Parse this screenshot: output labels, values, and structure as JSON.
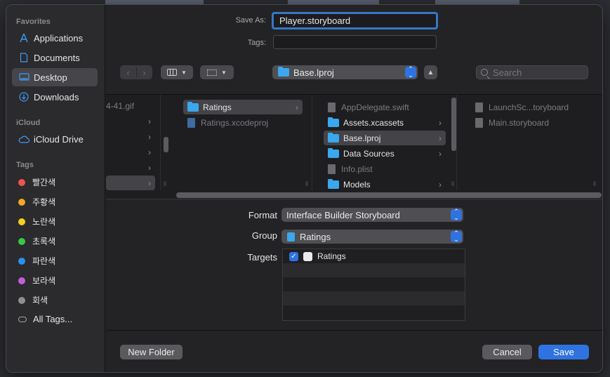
{
  "sidebar": {
    "favorites_header": "Favorites",
    "favorites": [
      {
        "label": "Applications",
        "icon": "applications-icon"
      },
      {
        "label": "Documents",
        "icon": "document-icon"
      },
      {
        "label": "Desktop",
        "icon": "desktop-icon",
        "selected": true
      },
      {
        "label": "Downloads",
        "icon": "downloads-icon"
      }
    ],
    "icloud_header": "iCloud",
    "icloud": [
      {
        "label": "iCloud Drive",
        "icon": "cloud-icon"
      }
    ],
    "tags_header": "Tags",
    "tags": [
      {
        "label": "빨간색",
        "color": "#ef5350"
      },
      {
        "label": "주황색",
        "color": "#f5a623"
      },
      {
        "label": "노란색",
        "color": "#f2d21b"
      },
      {
        "label": "초록색",
        "color": "#36c94a"
      },
      {
        "label": "파란색",
        "color": "#2d8ff2"
      },
      {
        "label": "보라색",
        "color": "#c25ed9"
      },
      {
        "label": "회색",
        "color": "#8e8e93"
      }
    ],
    "all_tags": "All Tags..."
  },
  "save_as": {
    "label": "Save As:",
    "value": "Player.storyboard"
  },
  "tags_field": {
    "label": "Tags:",
    "value": ""
  },
  "toolbar": {
    "back_icon": "chevron-left-icon",
    "forward_icon": "chevron-right-icon",
    "location": "Base.lproj",
    "search_placeholder": "Search"
  },
  "browser": {
    "col1": [
      {
        "label": "4-41.gif"
      }
    ],
    "col2": [
      {
        "label": "Ratings",
        "type": "folder",
        "selected": true,
        "has_children": true
      },
      {
        "label": "Ratings.xcodeproj",
        "type": "project",
        "dim": true
      }
    ],
    "col3": [
      {
        "label": "AppDelegate.swift",
        "type": "file",
        "dim": true
      },
      {
        "label": "Assets.xcassets",
        "type": "folder",
        "has_children": true
      },
      {
        "label": "Base.lproj",
        "type": "folder",
        "selected": true,
        "has_children": true
      },
      {
        "label": "Data Sources",
        "type": "folder",
        "has_children": true
      },
      {
        "label": "Info.plist",
        "type": "file",
        "dim": true
      },
      {
        "label": "Models",
        "type": "folder",
        "has_children": true
      }
    ],
    "col4": [
      {
        "label": "LaunchSc...toryboard",
        "dim": true
      },
      {
        "label": "Main.storyboard",
        "dim": true
      }
    ]
  },
  "form": {
    "format_label": "Format",
    "format_value": "Interface Builder Storyboard",
    "group_label": "Group",
    "group_value": "Ratings",
    "targets_label": "Targets",
    "targets": [
      {
        "label": "Ratings",
        "checked": true
      }
    ]
  },
  "buttons": {
    "new_folder": "New Folder",
    "cancel": "Cancel",
    "save": "Save"
  },
  "colors": {
    "accent": "#2f73e0",
    "folder": "#3aa7ee"
  }
}
